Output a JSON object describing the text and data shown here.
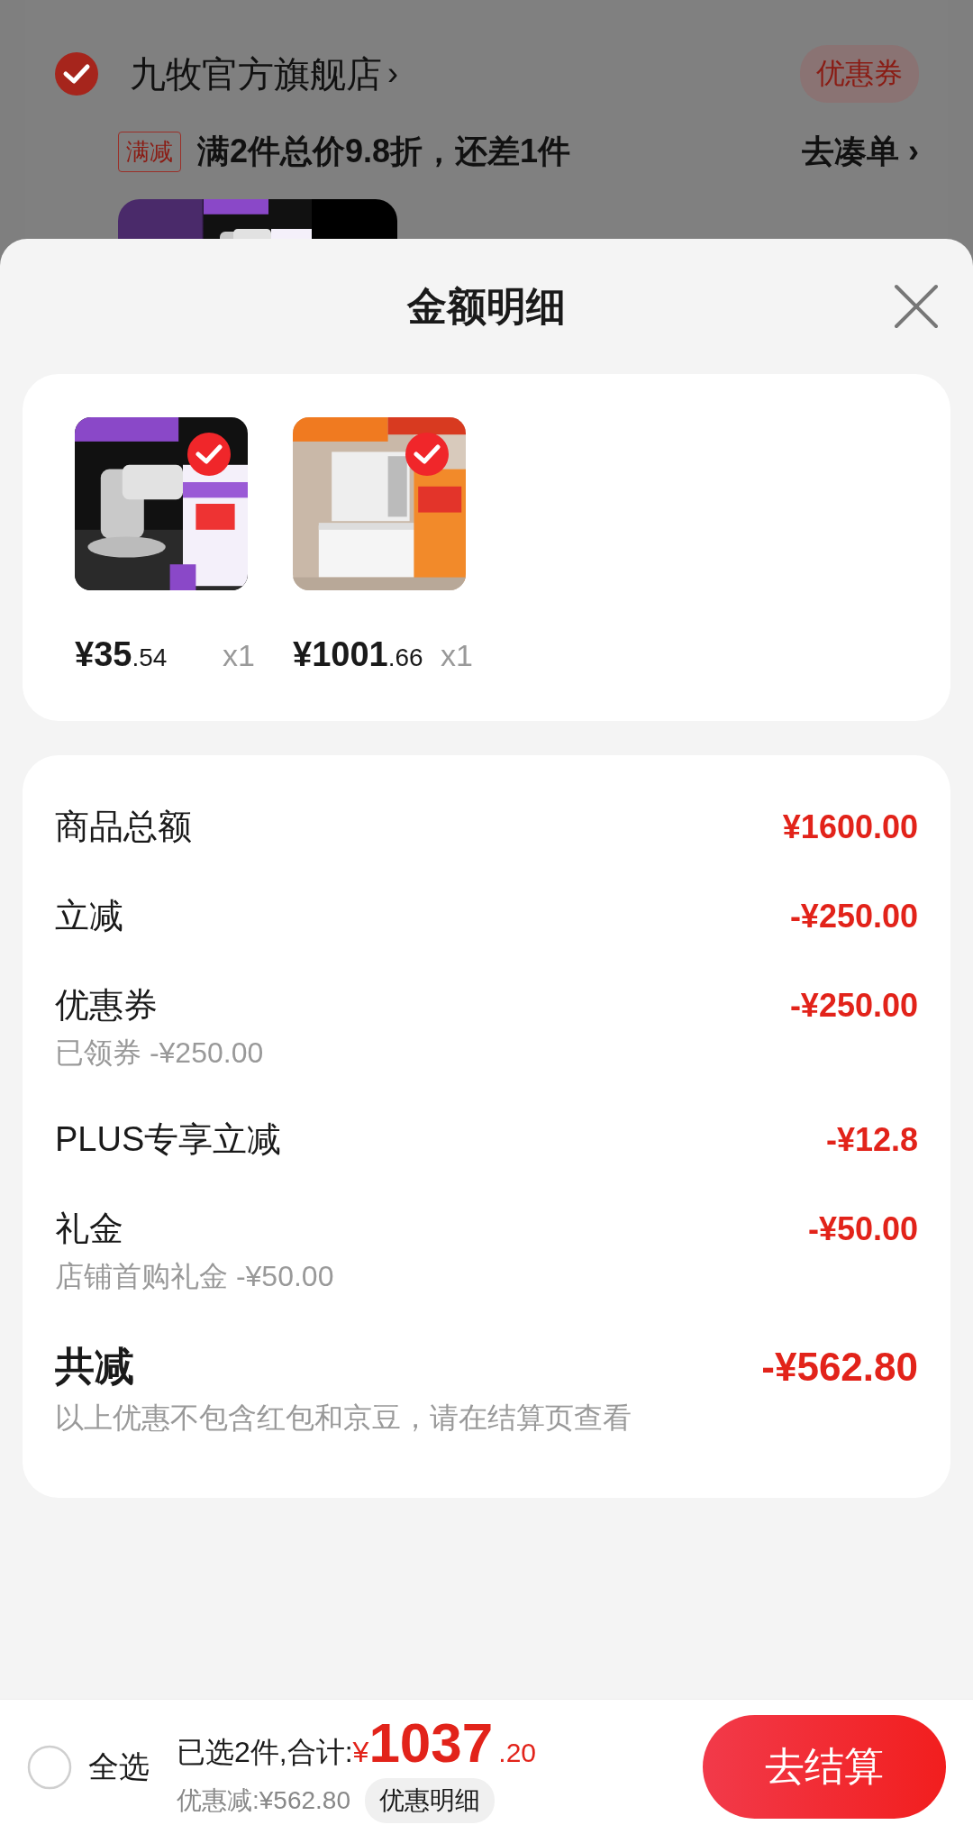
{
  "store": {
    "name": "九牧官方旗舰店",
    "arrow": "›",
    "checked": true,
    "coupon": "优惠券"
  },
  "promo": {
    "tag": "满减",
    "text": "满2件总价9.8折，还差1件",
    "action": "去凑单",
    "arrow": "›"
  },
  "sheet": {
    "title": "金额明细",
    "products": [
      {
        "price_int": "¥35",
        "price_dec": ".54",
        "qty": "x1",
        "selected": true
      },
      {
        "price_int": "¥1001",
        "price_dec": ".66",
        "qty": "x1",
        "selected": true
      }
    ],
    "rows": [
      {
        "kind": "item",
        "label": "商品总额",
        "amount": "¥1600.00"
      },
      {
        "kind": "item",
        "label": "立减",
        "amount": "-¥250.00"
      },
      {
        "kind": "item",
        "label": "优惠券",
        "amount": "-¥250.00",
        "note": "已领券 -¥250.00"
      },
      {
        "kind": "item",
        "label": "PLUS专享立减",
        "amount": "-¥12.8"
      },
      {
        "kind": "item",
        "label": "礼金",
        "amount": "-¥50.00",
        "note": "店铺首购礼金 -¥50.00"
      },
      {
        "kind": "total",
        "label": "共减",
        "amount": "-¥562.80",
        "note": "以上优惠不包含红包和京豆，请在结算页查看"
      }
    ]
  },
  "bottom_bar": {
    "select_all": {
      "label": "全选",
      "checked": false
    },
    "summary": "已选2件,合计:",
    "currency": "¥",
    "total_int": "1037",
    "total_dec": ".20",
    "discount": "优惠减:¥562.80",
    "detail_button": "优惠明细",
    "checkout": "去结算"
  }
}
